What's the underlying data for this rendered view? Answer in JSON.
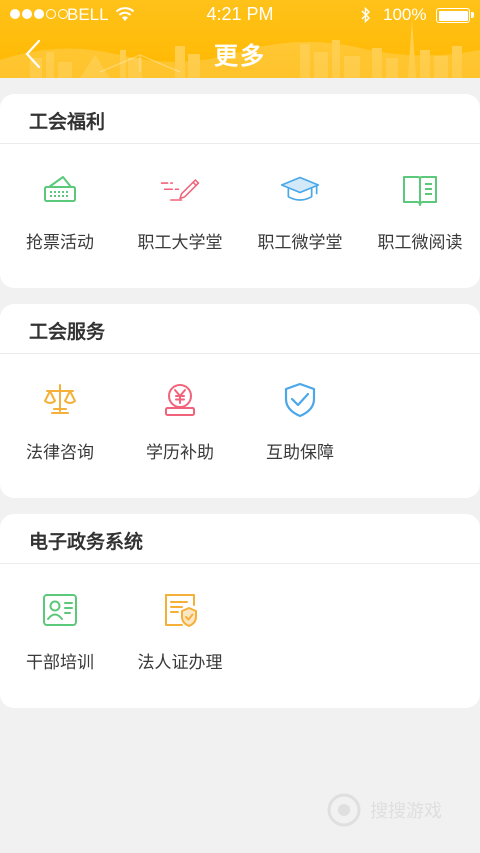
{
  "status_bar": {
    "carrier": "BELL",
    "time": "4:21 PM",
    "battery": "100%"
  },
  "header": {
    "title": "更多"
  },
  "sections": [
    {
      "title": "工会福利",
      "items": [
        {
          "label": "抢票活动",
          "icon": "ticket-icon",
          "color": "#5cc87a"
        },
        {
          "label": "职工大学堂",
          "icon": "pen-icon",
          "color": "#f0637a"
        },
        {
          "label": "职工微学堂",
          "icon": "graduation-cap-icon",
          "color": "#4aa8e8"
        },
        {
          "label": "职工微阅读",
          "icon": "book-icon",
          "color": "#5cc87a"
        }
      ]
    },
    {
      "title": "工会服务",
      "items": [
        {
          "label": "法律咨询",
          "icon": "scales-icon",
          "color": "#f5b03a"
        },
        {
          "label": "学历补助",
          "icon": "yuan-coin-icon",
          "color": "#f0637a"
        },
        {
          "label": "互助保障",
          "icon": "shield-check-icon",
          "color": "#4aa8e8"
        }
      ]
    },
    {
      "title": "电子政务系统",
      "items": [
        {
          "label": "干部培训",
          "icon": "id-card-icon",
          "color": "#5cc87a"
        },
        {
          "label": "法人证办理",
          "icon": "certificate-icon",
          "color": "#f5b03a"
        }
      ]
    }
  ],
  "watermark": {
    "text": "搜搜游戏"
  }
}
